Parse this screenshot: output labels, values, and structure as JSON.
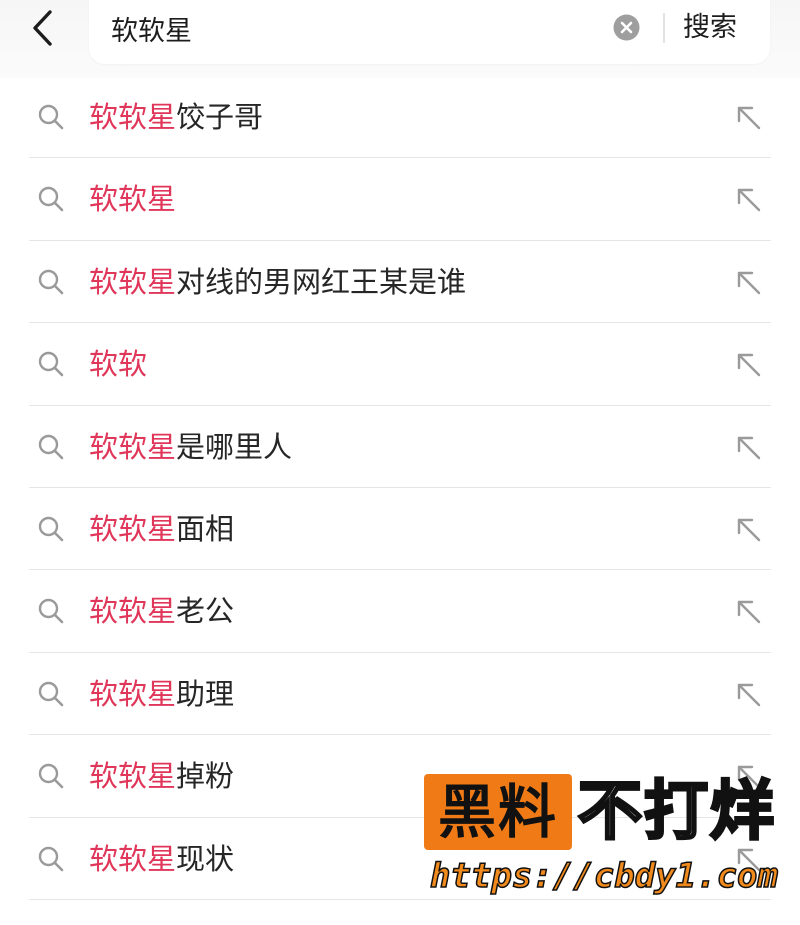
{
  "search": {
    "query": "软软星",
    "button_label": "搜索"
  },
  "suggestions": [
    {
      "match": "软软星",
      "rest": "饺子哥"
    },
    {
      "match": "软软星",
      "rest": ""
    },
    {
      "match": "软软星",
      "rest": "对线的男网红王某是谁"
    },
    {
      "match": "软软",
      "rest": ""
    },
    {
      "match": "软软星",
      "rest": "是哪里人"
    },
    {
      "match": "软软星",
      "rest": "面相"
    },
    {
      "match": "软软星",
      "rest": "老公"
    },
    {
      "match": "软软星",
      "rest": "助理"
    },
    {
      "match": "软软星",
      "rest": "掉粉"
    },
    {
      "match": "软软星",
      "rest": "现状"
    }
  ],
  "watermark": {
    "badge": "黑料",
    "main": "不打烊",
    "url": "https://cbdy1.com"
  },
  "colors": {
    "accent": "#e0365a",
    "text": "#262626",
    "icon": "#9a9a9a",
    "watermark_orange": "#f07b16"
  },
  "icons": {
    "back": "chevron-left-icon",
    "clear": "clear-circle-icon",
    "row_search": "search-icon",
    "row_fill": "arrow-up-left-icon"
  }
}
